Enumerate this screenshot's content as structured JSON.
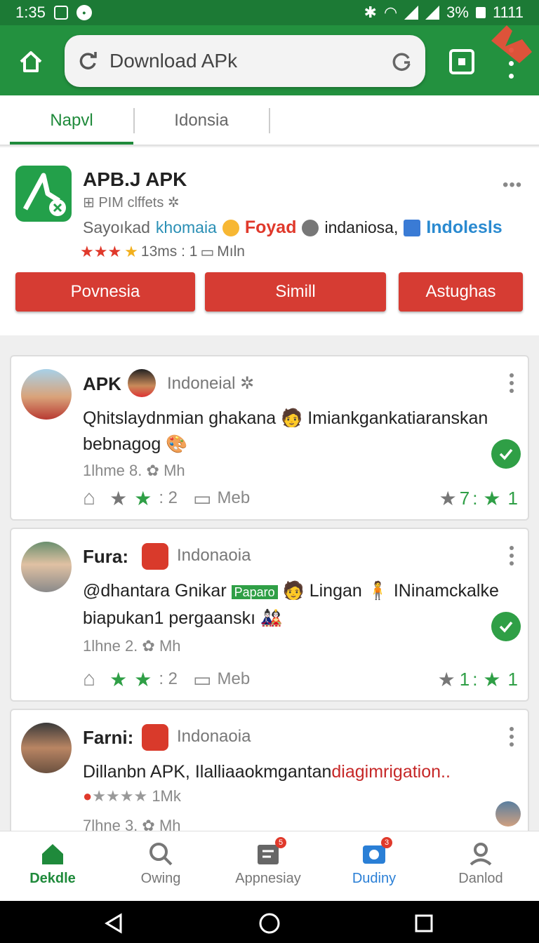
{
  "status_bar": {
    "time": "1:35",
    "battery_percent": "3%",
    "battery_extra": "1111"
  },
  "browser": {
    "url_text": "Download APk"
  },
  "tabs": [
    {
      "label": "Napvl"
    },
    {
      "label": "Idonsia"
    }
  ],
  "app": {
    "title": "APB.J APK",
    "subtitle": "PIM clffets",
    "tags": [
      "Sayoıkad",
      "khomaia",
      "Foyad",
      "indaniosa,",
      "Indolesls"
    ],
    "rating_text": "13ms : 1",
    "rating_extra": "Mıln",
    "buttons": [
      "Povnesia",
      "Simill",
      "Astughas"
    ]
  },
  "posts": [
    {
      "name": "APK",
      "country": "Indoneial",
      "text_line1": "Qhitslaydnmian ghakana",
      "text_line1b": "Imiankgankatiaranskan",
      "text_line2": "bebnagog",
      "time": "1lhme 8.",
      "time_unit": "Mh",
      "like_count": ": 2",
      "comment_label": "Meb",
      "score_left": "7",
      "score_right": "1"
    },
    {
      "name": "Fura:",
      "country": "Indonaoia",
      "text_line1": "@dhantara Gnikar",
      "tag": "Paparo",
      "text_line1b": "Lingan",
      "text_line1c": "INinamckalke",
      "text_line2": "biapukan1 pergaanskı",
      "time": "1lhne 2.",
      "time_unit": "Mh",
      "like_count": ": 2",
      "comment_label": "Meb",
      "score_left": "1",
      "score_right": "1"
    },
    {
      "name": "Farni:",
      "country": "Indonaoia",
      "text_line1": "Dillanbn APK, Ilalliaaokmgantan",
      "text_line1_red": "diagimrigation..",
      "rating_text": "1Mk",
      "time": "7lhne 3.",
      "time_unit": "Mh"
    }
  ],
  "bottom_nav": [
    {
      "label": "Dekdle",
      "badge": ""
    },
    {
      "label": "Owing",
      "badge": ""
    },
    {
      "label": "Appnesiay",
      "badge": "5"
    },
    {
      "label": "Dudiny",
      "badge": "3"
    },
    {
      "label": "Danlod",
      "badge": ""
    }
  ],
  "colors": {
    "brand_green": "#23913f",
    "accent_red": "#d63c33",
    "link_blue": "#2a8ad0"
  }
}
